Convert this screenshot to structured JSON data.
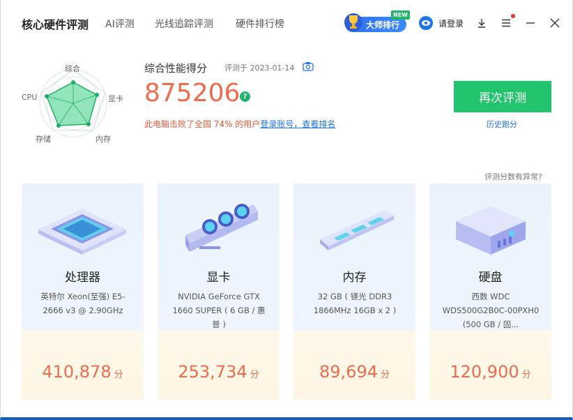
{
  "header": {
    "app_title": "核心硬件评测",
    "tabs": [
      "AI评测",
      "光线追踪评测",
      "硬件排行榜"
    ],
    "master_rank_label": "大师排行",
    "new_badge": "NEW",
    "login_label": "请登录"
  },
  "radar": {
    "labels": {
      "top": "综合",
      "right": "显卡",
      "bottom_right": "内存",
      "bottom_left": "存储",
      "left": "CPU"
    }
  },
  "score": {
    "title": "综合性能得分",
    "date": "评测于 2023-01-14",
    "value": "875206",
    "beat_text": "此电脑击败了全国 74% 的用户",
    "beat_link": "登录账号，查看排名",
    "help_glyph": "?"
  },
  "actions": {
    "retest_label": "再次评测",
    "history_label": "历史跑分",
    "abnormal_label": "评测分数有异常?"
  },
  "cards": [
    {
      "name": "处理器",
      "desc": "英特尔 Xeon(至强) E5-2666 v3 @ 2.90GHz",
      "score": "410,878",
      "unit": "分"
    },
    {
      "name": "显卡",
      "desc": "NVIDIA GeForce GTX 1660 SUPER ( 6 GB / 惠普 )",
      "score": "253,734",
      "unit": "分"
    },
    {
      "name": "内存",
      "desc": "32 GB ( 镁光 DDR3 1866MHz 16GB x 2 )",
      "score": "89,694",
      "unit": "分"
    },
    {
      "name": "硬盘",
      "desc": "西数 WDC WDS500G2B0C-00PXH0 (500 GB / 固...",
      "score": "120,900",
      "unit": "分"
    }
  ],
  "colors": {
    "accent_green": "#22c46e",
    "score_orange": "#f06b4d",
    "link_blue": "#1e74e8"
  }
}
